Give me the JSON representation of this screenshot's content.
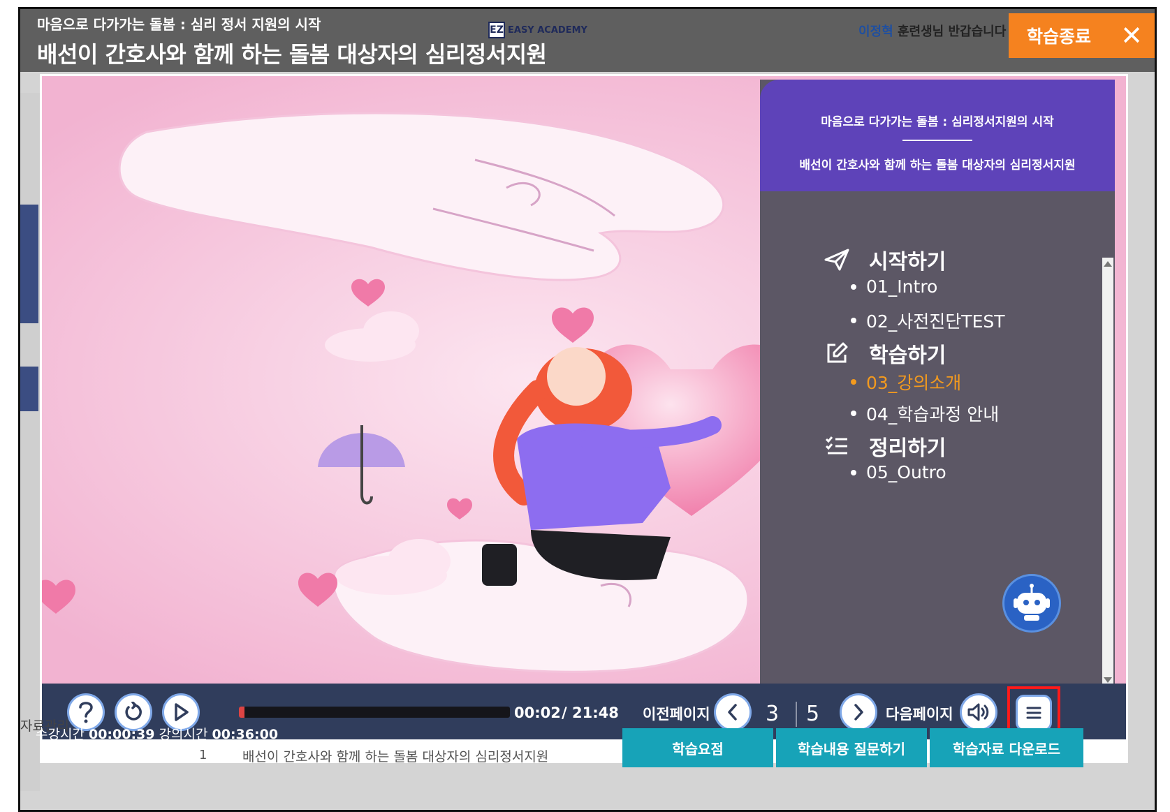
{
  "header": {
    "course_title": "마음으로 다가가는 돌봄 : 심리 정서 지원의 시작",
    "lecture_title": "배선이 간호사와 함께 하는 돌봄 대상자의 심리정서지원",
    "brand_logo": "EZ",
    "brand_name": "EASY ACADEMY",
    "user_name": "이정혁",
    "greeting_suffix": " 훈련생님 반갑습니다",
    "end_label": "학습종료",
    "end_icon": "close-icon"
  },
  "menu": {
    "course": "마음으로 다가가는 돌봄 : 심리정서지원의 시작",
    "lecture": "배선이 간호사와 함께 하는 돌봄 대상자의 심리정서지원",
    "sections": [
      {
        "label": "시작하기",
        "icon": "paper-plane-icon"
      },
      {
        "label": "학습하기",
        "icon": "edit-icon"
      },
      {
        "label": "정리하기",
        "icon": "checklist-icon"
      }
    ],
    "items": [
      {
        "label": "01_Intro"
      },
      {
        "label": "02_사전진단TEST"
      },
      {
        "label": "03_강의소개",
        "active": true
      },
      {
        "label": "04_학습과정 안내"
      },
      {
        "label": "05_Outro"
      }
    ]
  },
  "controls": {
    "elapsed": "00:02",
    "duration": "/ 21:48",
    "progress": 0.02,
    "prev_label": "이전페이지",
    "next_label": "다음페이지",
    "current_page": "3",
    "total_pages": "5",
    "icons": [
      "help-icon",
      "replay-icon",
      "play-icon",
      "chevron-left-icon",
      "chevron-right-icon",
      "speaker-icon",
      "menu-icon"
    ]
  },
  "footer": {
    "study_label": "수강시간",
    "study_time": "00:00:39",
    "lecture_label": "강의시간",
    "lecture_time": "00:36:00",
    "row_no": "1",
    "row_title": "배선이 간호사와 함께 하는 돌봄 대상자의 심리정서지원",
    "manage_label": "자료관리",
    "buttons": [
      "학습요점",
      "학습내용 질문하기",
      "학습자료 다운로드"
    ]
  },
  "colors": {
    "accent_orange": "#f5821f",
    "menu_purple": "#5e43b9",
    "active_item": "#f39a1e",
    "footer_button": "#17a3b8",
    "control_bar": "#303d5c"
  }
}
